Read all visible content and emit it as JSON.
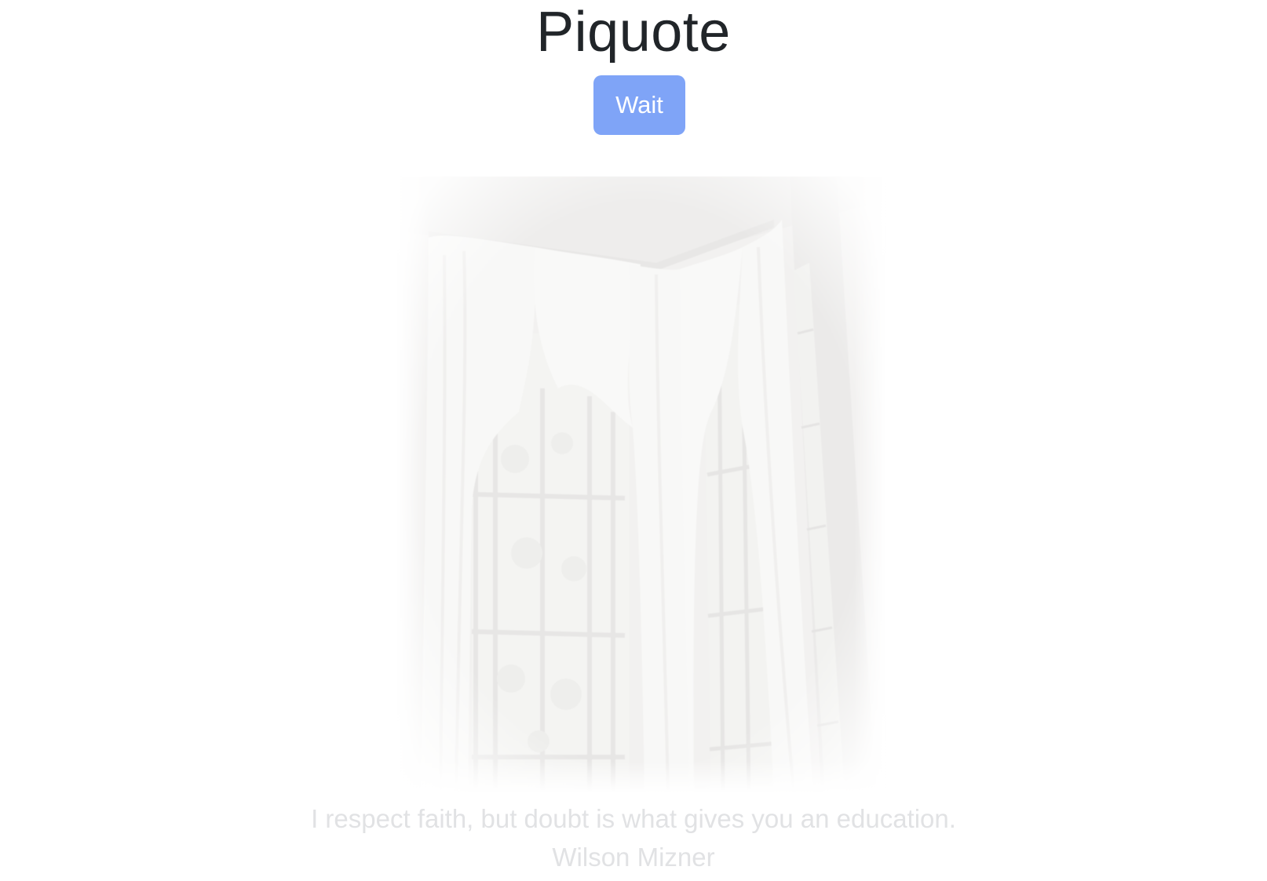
{
  "app": {
    "title": "Piquote"
  },
  "controls": {
    "wait_label": "Wait"
  },
  "quote": {
    "image_icon": "window-curtains-photo",
    "text": "I respect faith, but doubt is what gives you an education.",
    "author": "Wilson Mizner"
  },
  "colors": {
    "title": "#212529",
    "button_bg": "#7fa4f7",
    "button_text": "#ffffff",
    "faded_text": "#e1e2e4",
    "image_base": "#f6f5f4"
  }
}
